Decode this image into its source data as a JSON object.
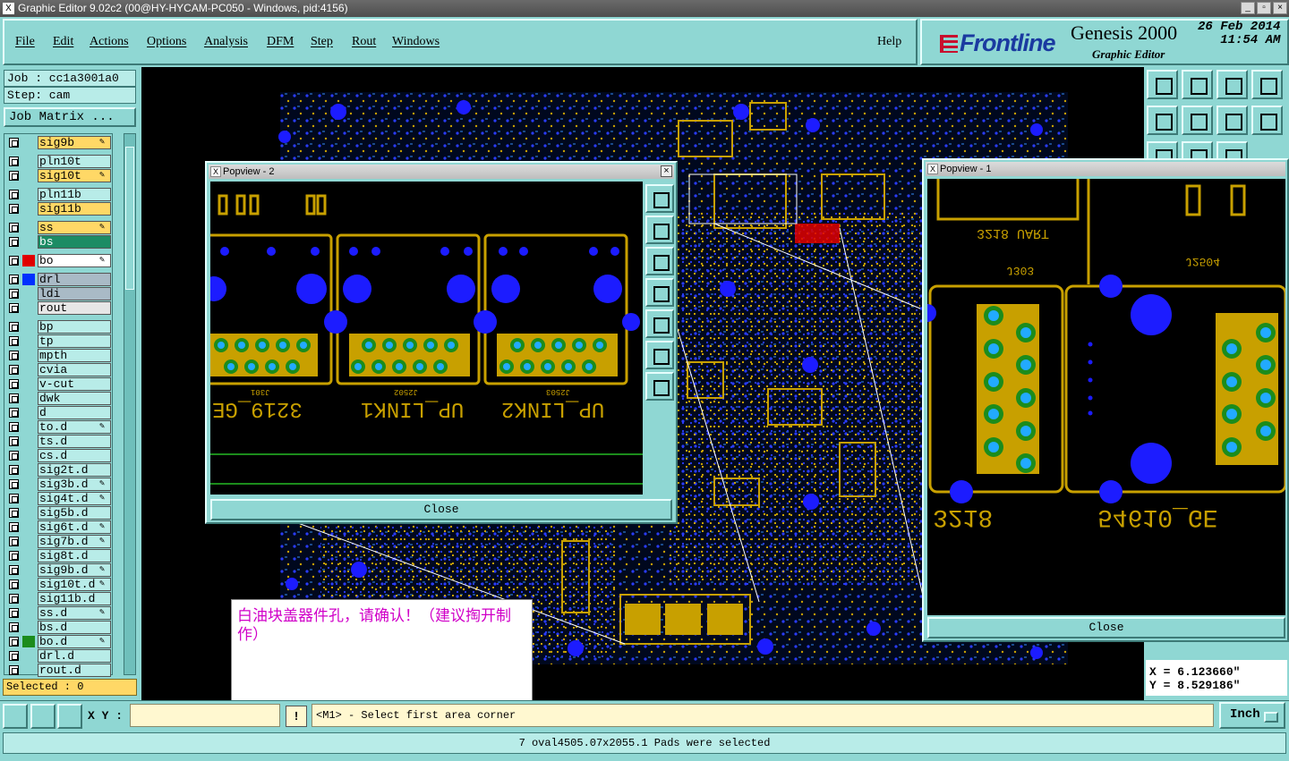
{
  "window": {
    "title": "Graphic Editor 9.02c2 (00@HY-HYCAM-PC050 - Windows, pid:4156)"
  },
  "menu": {
    "items": [
      "File",
      "Edit",
      "Actions",
      "Options",
      "Analysis",
      "DFM",
      "Step",
      "Rout",
      "Windows"
    ],
    "help": "Help"
  },
  "brand": {
    "logo": "Frontline",
    "product": "Genesis 2000",
    "subtitle": "Graphic Editor",
    "date": "26 Feb 2014",
    "time": "11:54 AM"
  },
  "job": {
    "job_label": "Job : cc1a3001a0",
    "step_label": "Step: cam",
    "matrix_button": "Job Matrix ..."
  },
  "layers": [
    {
      "name": "sig9b",
      "bg": "#ffd866",
      "swatch": "",
      "edit": true
    },
    {
      "name": "pln10t",
      "bg": "#b8ece8",
      "swatch": "",
      "edit": false
    },
    {
      "name": "sig10t",
      "bg": "#ffd866",
      "swatch": "",
      "edit": true
    },
    {
      "name": "pln11b",
      "bg": "#b8ece8",
      "swatch": "",
      "edit": false
    },
    {
      "name": "sig11b",
      "bg": "#ffd866",
      "swatch": "",
      "edit": false
    },
    {
      "name": "ss",
      "bg": "#ffd866",
      "swatch": "",
      "edit": true
    },
    {
      "name": "bs",
      "bg": "#1c8c64",
      "swatch": "",
      "edit": false
    },
    {
      "name": "bo",
      "bg": "#ffffff",
      "swatch": "#e00000",
      "edit": true
    },
    {
      "name": "drl",
      "bg": "#a9bac6",
      "swatch": "#0030ff",
      "edit": false
    },
    {
      "name": "ldi",
      "bg": "#a9bac6",
      "swatch": "",
      "edit": false
    },
    {
      "name": "rout",
      "bg": "#e6e6e6",
      "swatch": "",
      "edit": false
    },
    {
      "name": "bp",
      "bg": "#b8ece8",
      "swatch": "",
      "edit": false
    },
    {
      "name": "tp",
      "bg": "#b8ece8",
      "swatch": "",
      "edit": false
    },
    {
      "name": "mpth",
      "bg": "#b8ece8",
      "swatch": "",
      "edit": false
    },
    {
      "name": "cvia",
      "bg": "#b8ece8",
      "swatch": "",
      "edit": false
    },
    {
      "name": "v-cut",
      "bg": "#b8ece8",
      "swatch": "",
      "edit": false
    },
    {
      "name": "dwk",
      "bg": "#b8ece8",
      "swatch": "",
      "edit": false
    },
    {
      "name": "d",
      "bg": "#b8ece8",
      "swatch": "",
      "edit": false
    },
    {
      "name": "to.d",
      "bg": "#b8ece8",
      "swatch": "",
      "edit": true
    },
    {
      "name": "ts.d",
      "bg": "#b8ece8",
      "swatch": "",
      "edit": false
    },
    {
      "name": "cs.d",
      "bg": "#b8ece8",
      "swatch": "",
      "edit": false
    },
    {
      "name": "sig2t.d",
      "bg": "#b8ece8",
      "swatch": "",
      "edit": false
    },
    {
      "name": "sig3b.d",
      "bg": "#b8ece8",
      "swatch": "",
      "edit": true
    },
    {
      "name": "sig4t.d",
      "bg": "#b8ece8",
      "swatch": "",
      "edit": true
    },
    {
      "name": "sig5b.d",
      "bg": "#b8ece8",
      "swatch": "",
      "edit": false
    },
    {
      "name": "sig6t.d",
      "bg": "#b8ece8",
      "swatch": "",
      "edit": true
    },
    {
      "name": "sig7b.d",
      "bg": "#b8ece8",
      "swatch": "",
      "edit": true
    },
    {
      "name": "sig8t.d",
      "bg": "#b8ece8",
      "swatch": "",
      "edit": false
    },
    {
      "name": "sig9b.d",
      "bg": "#b8ece8",
      "swatch": "",
      "edit": true
    },
    {
      "name": "sig10t.d",
      "bg": "#b8ece8",
      "swatch": "",
      "edit": true
    },
    {
      "name": "sig11b.d",
      "bg": "#b8ece8",
      "swatch": "",
      "edit": false
    },
    {
      "name": "ss.d",
      "bg": "#b8ece8",
      "swatch": "",
      "edit": true
    },
    {
      "name": "bs.d",
      "bg": "#b8ece8",
      "swatch": "",
      "edit": false
    },
    {
      "name": "bo.d",
      "bg": "#b8ece8",
      "swatch": "#1c8c1c",
      "edit": true
    },
    {
      "name": "drl.d",
      "bg": "#b8ece8",
      "swatch": "",
      "edit": false
    },
    {
      "name": "rout.d",
      "bg": "#b8ece8",
      "swatch": "",
      "edit": false
    }
  ],
  "selected": "Selected : 0",
  "coords": {
    "x": "X =  6.123660\"",
    "y": "Y =  8.529186\""
  },
  "bottom": {
    "xy_label": "X Y :",
    "message": "<M1> - Select first area corner",
    "units": "Inch"
  },
  "status": "7 oval4505.07x2055.1 Pads were selected",
  "popview2": {
    "title": "Popview - 2",
    "close": "Close",
    "labels": {
      "a": "3219_GE",
      "b": "UP_LINK1",
      "c": "UP_LINK2",
      "j1": "J301",
      "j2": "J2502",
      "j3": "J2503"
    }
  },
  "popview1": {
    "title": "Popview - 1",
    "close": "Close",
    "labels": {
      "a": "3218",
      "b": "54610_GE",
      "uart": "3218 UART",
      "j303": "J303",
      "j2504": "J2504"
    }
  },
  "note": "白油块盖器件孔，请确认！（建议掏开制作）",
  "colors": {
    "panel": "#8fd7d3",
    "gold": "#c8a000",
    "blue": "#1c1cff",
    "canvas": "#000000"
  }
}
